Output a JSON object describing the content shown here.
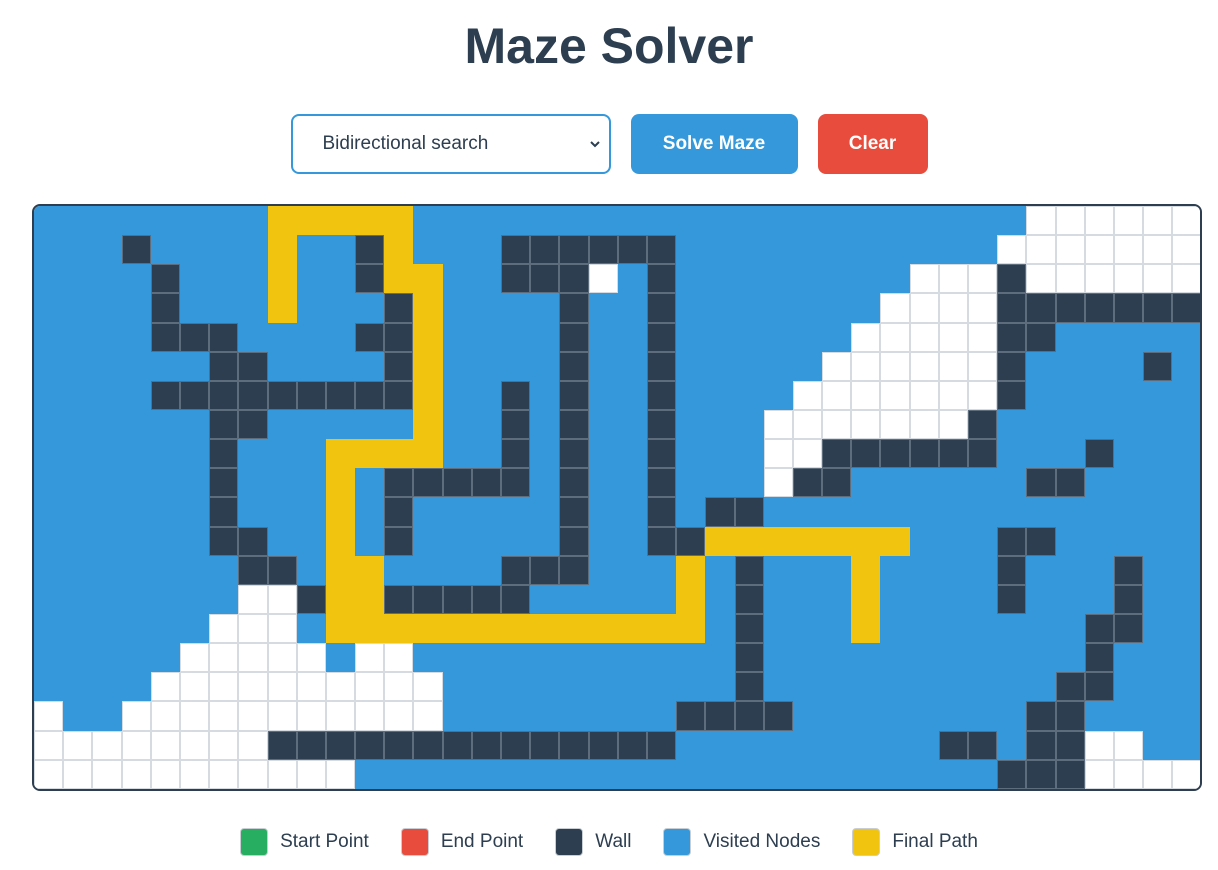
{
  "title": "Maze Solver",
  "controls": {
    "algorithm_selected": "Bidirectional search",
    "solve_label": "Solve Maze",
    "clear_label": "Clear"
  },
  "colors": {
    "empty": "#ffffff",
    "visited": "#3498db",
    "wall": "#2c3e50",
    "path": "#f1c40f",
    "start": "#27ae60",
    "end": "#e74c3c"
  },
  "grid": {
    "cols": 40,
    "rows": 20,
    "legend_key": {
      ".": "empty",
      "v": "visited",
      "#": "wall",
      "P": "path"
    },
    "cells": [
      "vvvvvvvvPPPPPvvvvvvvvvvvvvvvvvvvvv......",
      "vvv#vvvvPvv#Pvvv######vvvvvvvvvvv.......",
      "vvvv#vvvPvv#PPvv###.v#vvvvvvvv...#......",
      "vvvv#vvvPvvv#Pvvvv#vv#vvvvvvv....#######",
      "vvvv###vvvv##Pvvvv#vv#vvvvvv.....##vvvvv",
      "vvvvvv##vvvv#Pvvvv#vv#vvvvv......#vvvv#v",
      "vvvv#########Pvv#v#vv#vvvv.......#vvvvvv",
      "vvvvvv##vvvvvPvv#v#vv#vvv.......#vvvvvvv",
      "vvvvvv#vvvPPPPvv#v#vv#vvv..######vvv#vvv",
      "vvvvvv#vvvPv#####v#vv#vvv.##vvvvvv##vvvv",
      "vvvvvv#vvvPv#vvvvv#vv#v##vvvvvvvvvvvvvvv",
      "vvvvvv##vvPv#vvvvv#vv##PPPPPPPvvv##vvvvv",
      "vvvvvvv##vPPvvvv###vvvPv#vvvPvvvv#vvv#vv",
      "vvvvvvv..#PP#####vvvvvPv#vvvPvvvv#vvv#vv",
      "vvvvvv...vPPPPPPPPPPPPPv#vvvPvvvvvvv##vv",
      "vvvvv.....v..vvvvvvvvvvv#vvvvvvvvvvv#vvv",
      "vvvv..........vvvvvvvvvv#vvvvvvvvvv##vvv",
      ".vv...........vvvvvvvv####vvvvvvvv##vvvv",
      "........##############vvvvvvvvv##v##..vv",
      "...........vvvvvvvvvvvvvvvvvvvvvv###....v"
    ]
  },
  "legend": [
    {
      "label": "Start Point",
      "color": "#27ae60"
    },
    {
      "label": "End Point",
      "color": "#e74c3c"
    },
    {
      "label": "Wall",
      "color": "#2c3e50"
    },
    {
      "label": "Visited Nodes",
      "color": "#3498db"
    },
    {
      "label": "Final Path",
      "color": "#f1c40f"
    }
  ]
}
